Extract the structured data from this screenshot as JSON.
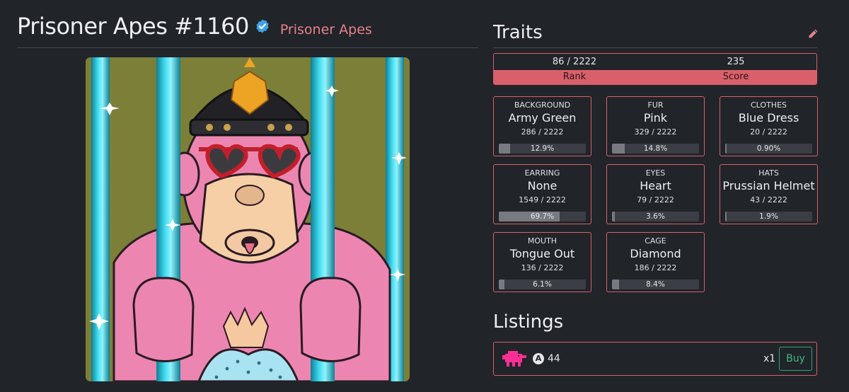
{
  "nft": {
    "title": "Prisoner Apes #1160",
    "collection": "Prisoner Apes"
  },
  "icons": {
    "verified": "verified-check-icon",
    "edit": "pencil-icon",
    "marketplace": "pink-pixel-creature-icon",
    "currency": "algo-icon"
  },
  "colors": {
    "accent": "#d9606a",
    "collection_link": "#e7828b",
    "buy": "#3dbb82",
    "verified": "#3fa2e6",
    "background": "#212429"
  },
  "traits_section": {
    "title": "Traits",
    "rank_value": "86 / 2222",
    "score_value": "235",
    "rank_label": "Rank",
    "score_label": "Score"
  },
  "traits": [
    {
      "type": "BACKGROUND",
      "value": "Army Green",
      "count": "286 / 2222",
      "percent": "12.9%",
      "fill": 0.129
    },
    {
      "type": "FUR",
      "value": "Pink",
      "count": "329 / 2222",
      "percent": "14.8%",
      "fill": 0.148
    },
    {
      "type": "CLOTHES",
      "value": "Blue Dress",
      "count": "20 / 2222",
      "percent": "0.90%",
      "fill": 0.009
    },
    {
      "type": "EARRING",
      "value": "None",
      "count": "1549 / 2222",
      "percent": "69.7%",
      "fill": 0.697
    },
    {
      "type": "EYES",
      "value": "Heart",
      "count": "79 / 2222",
      "percent": "3.6%",
      "fill": 0.036
    },
    {
      "type": "HATS",
      "value": "Prussian Helmet",
      "count": "43 / 2222",
      "percent": "1.9%",
      "fill": 0.019
    },
    {
      "type": "MOUTH",
      "value": "Tongue Out",
      "count": "136 / 2222",
      "percent": "6.1%",
      "fill": 0.061
    },
    {
      "type": "CAGE",
      "value": "Diamond",
      "count": "186 / 2222",
      "percent": "8.4%",
      "fill": 0.084
    }
  ],
  "listings": {
    "title": "Listings",
    "items": [
      {
        "currency_symbol": "A",
        "price": "44",
        "quantity": "x1",
        "buy_label": "Buy"
      }
    ]
  }
}
